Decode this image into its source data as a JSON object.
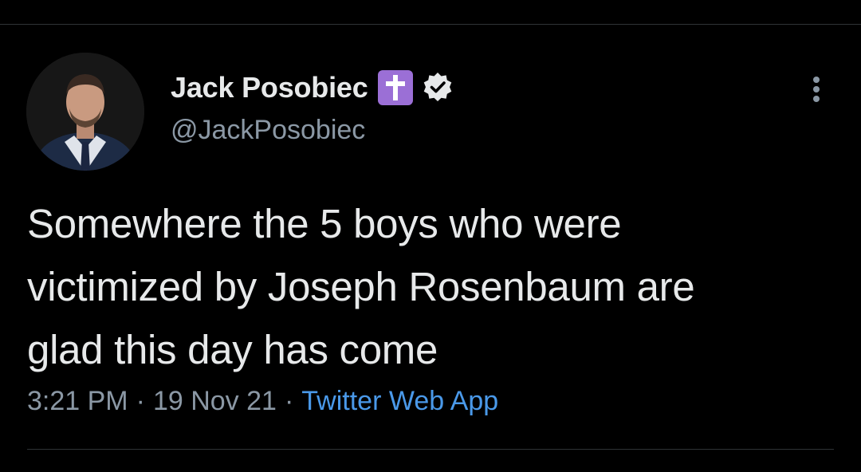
{
  "tweet": {
    "author": {
      "display_name": "Jack Posobiec",
      "handle": "@JackPosobiec",
      "badge_icon": "latin-cross-icon",
      "verified_icon": "verified-badge-icon"
    },
    "text": "Somewhere the 5 boys who were\nvictimized by Joseph Rosenbaum are\nglad this day has come",
    "meta": {
      "time": "3:21 PM",
      "separator": "·",
      "date": "19 Nov 21",
      "source": "Twitter Web App"
    },
    "more_icon": "more-options-icon"
  },
  "colors": {
    "background": "#000000",
    "text_primary": "#e7e9ea",
    "text_secondary": "#8b98a5",
    "link": "#4a99e9",
    "cross_badge": "#9b6fd6"
  }
}
